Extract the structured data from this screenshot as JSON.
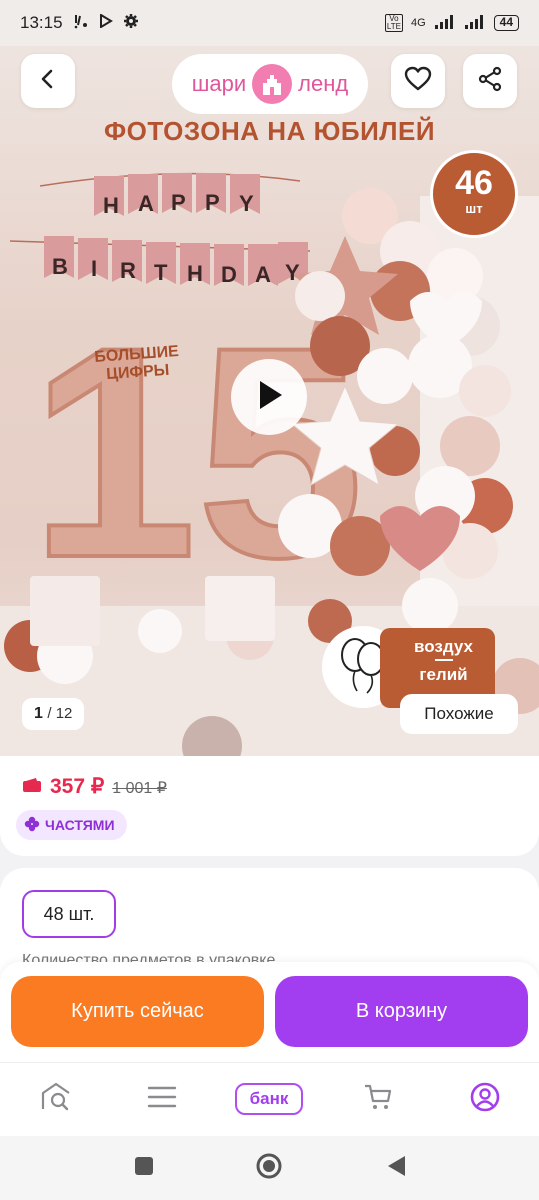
{
  "status_bar": {
    "time": "13:15",
    "network_label": "4G",
    "volte_label": "Vo LTE",
    "battery": "44"
  },
  "header": {
    "brand_left": "шари",
    "brand_right": "ленд"
  },
  "hero": {
    "headline": "ФОТОЗОНА НА ЮБИЛЕЙ",
    "badge_count": "46",
    "badge_unit": "шт",
    "banner_row1": [
      "H",
      "A",
      "P",
      "P",
      "Y"
    ],
    "banner_row2": [
      "B",
      "I",
      "R",
      "T",
      "H",
      "D",
      "A",
      "Y"
    ],
    "big_number": "15",
    "big_digits_label_1": "БОЛЬШИЕ",
    "big_digits_label_2": "ЦИФРЫ",
    "helium_line1": "воздух",
    "helium_line2": "гелий",
    "counter_current": "1",
    "counter_total": "/ 12",
    "similar_label": "Похожие"
  },
  "price": {
    "current": "357 ₽",
    "old": "1 001 ₽",
    "installments_label": "ЧАСТЯМИ"
  },
  "options": {
    "selected_chip": "48 шт.",
    "quantity_caption": "Количество предметов в упаковке"
  },
  "actions": {
    "buy_now": "Купить сейчас",
    "add_to_cart": "В корзину"
  },
  "bottom_nav": {
    "bank_label": "банк"
  },
  "colors": {
    "accent_purple": "#a33ef0",
    "accent_orange": "#fa7b22",
    "price_red": "#e62a4f",
    "brand_pink": "#e0569a"
  },
  "icons": [
    "back-arrow-icon",
    "heart-icon",
    "share-icon",
    "play-icon",
    "balloons-icon",
    "wallet-icon",
    "installments-icon",
    "home-search-icon",
    "menu-icon",
    "cart-icon",
    "profile-icon",
    "square-icon",
    "circle-icon",
    "triangle-back-icon"
  ]
}
